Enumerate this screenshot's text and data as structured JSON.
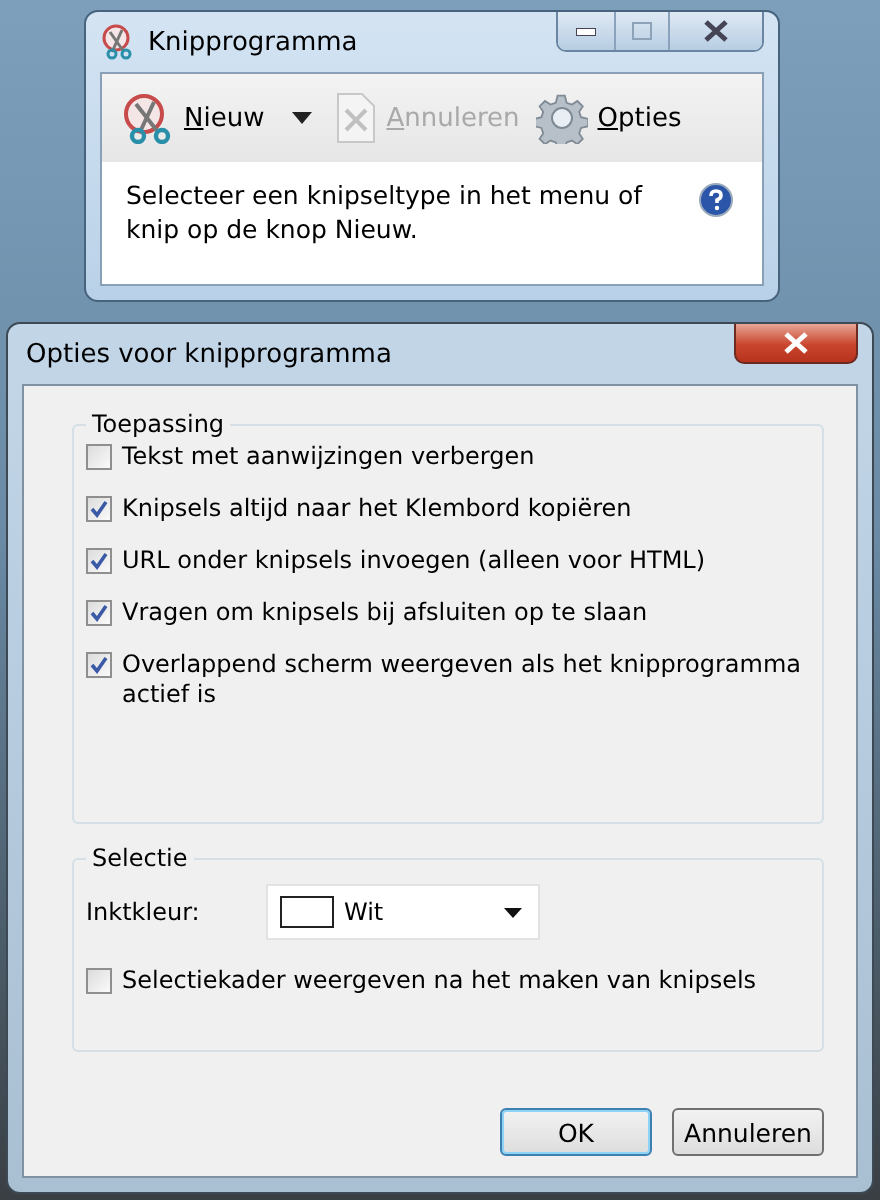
{
  "app_window": {
    "title": "Knipprogramma",
    "toolbar": [
      {
        "kind": "new",
        "label": "Nieuw",
        "disabled": false,
        "dropdown": true
      },
      {
        "kind": "cancel",
        "label": "Annuleren",
        "disabled": true,
        "dropdown": false
      },
      {
        "kind": "options",
        "label": "Opties",
        "disabled": false,
        "dropdown": false
      }
    ],
    "hint": "Selecteer een knipseltype in het menu of knip op de knop Nieuw."
  },
  "dialog": {
    "title": "Opties voor knipprogramma",
    "application_group": {
      "title": "Toepassing",
      "options": [
        {
          "label": "Tekst met aanwijzingen verbergen",
          "checked": false
        },
        {
          "label": "Knipsels altijd naar het Klembord kopiëren",
          "checked": true
        },
        {
          "label": "URL onder knipsels invoegen (alleen voor HTML)",
          "checked": true
        },
        {
          "label": "Vragen om knipsels bij afsluiten op te slaan",
          "checked": true
        },
        {
          "label": "Overlappend scherm weergeven als het knipprogramma actief is",
          "checked": true
        }
      ]
    },
    "selection_group": {
      "title": "Selectie",
      "ink_label": "Inktkleur:",
      "ink_value": "Wit",
      "options": [
        {
          "label": "Selectiekader weergeven na het maken van knipsels",
          "checked": false
        }
      ]
    },
    "buttons": [
      {
        "label": "OK",
        "default": true
      },
      {
        "label": "Annuleren",
        "default": false
      }
    ]
  }
}
